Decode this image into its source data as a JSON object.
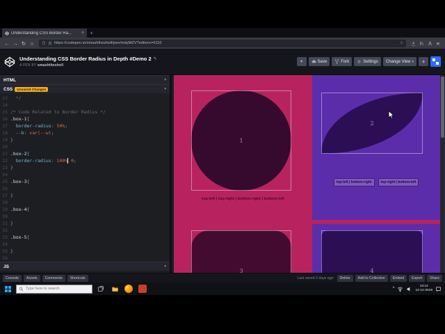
{
  "colors": {
    "pink": "#b8235f",
    "purple": "#5c2dab",
    "shape1": "#360a2e",
    "shape2": "#2c0e55",
    "shape3": "#430b30",
    "shape4": "#2c0e55"
  },
  "browser": {
    "tab_title": "Understanding CSS Border Ra...",
    "close_glyph": "×",
    "new_tab_glyph": "+",
    "back_glyph": "←",
    "forward_glyph": "→",
    "reload_glyph": "↻",
    "home_glyph": "⌂",
    "menu_glyph": "≡",
    "star_glyph": "☆",
    "url": "https://codepen.io/smashtheshell/pen/mdyMZV?editors=0110"
  },
  "pen_header": {
    "title": "Understanding CSS Border Radius in Depth #Demo 2",
    "edit_glyph": "✎",
    "byline_prefix": "A PEN BY",
    "author": "smashtheshell",
    "heart_glyph": "♥",
    "save_label": "Save",
    "fork_label": "Fork",
    "settings_label": "Settings",
    "change_view_label": "Change View",
    "caret_glyph": "▾"
  },
  "editors": {
    "html_label": "HTML",
    "css_label": "CSS",
    "css_badge": "Unsaved Changes",
    "js_label": "JS",
    "caret_glyph": "▾",
    "code_lines": [
      {
        "n": "13",
        "s": [
          {
            "c": "cm",
            "t": "  */"
          }
        ]
      },
      {
        "n": "14",
        "s": []
      },
      {
        "n": "15",
        "s": [
          {
            "c": "cm",
            "t": "/* Code Related to Border Radius */"
          }
        ]
      },
      {
        "n": "16",
        "s": [
          {
            "c": "sel",
            "t": ".box-1"
          },
          {
            "c": "pun",
            "t": "{"
          }
        ]
      },
      {
        "n": "17",
        "s": [
          {
            "c": "prop",
            "t": "  border-radius"
          },
          {
            "c": "pun",
            "t": ":"
          },
          {
            "c": "val",
            "t": " 50%"
          },
          {
            "c": "pun",
            "t": ";"
          }
        ]
      },
      {
        "n": "18",
        "s": [
          {
            "c": "prop",
            "t": "  --b"
          },
          {
            "c": "pun",
            "t": ":"
          },
          {
            "c": "val",
            "t": " var(--w)"
          },
          {
            "c": "pun",
            "t": ";"
          }
        ]
      },
      {
        "n": "19",
        "s": [
          {
            "c": "pun",
            "t": "}"
          }
        ]
      },
      {
        "n": "20",
        "s": []
      },
      {
        "n": "21",
        "s": [
          {
            "c": "sel",
            "t": ".box-2"
          },
          {
            "c": "pun",
            "t": "{"
          }
        ]
      },
      {
        "n": "22",
        "s": [
          {
            "c": "prop",
            "t": "  border-radius"
          },
          {
            "c": "pun",
            "t": ":"
          },
          {
            "c": "val",
            "t": " 100%"
          },
          {
            "c": "cursor",
            "t": ""
          },
          {
            "c": "val",
            "t": " 0"
          },
          {
            "c": "pun",
            "t": ";"
          }
        ]
      },
      {
        "n": "23",
        "s": [
          {
            "c": "pun",
            "t": "}"
          }
        ]
      },
      {
        "n": "24",
        "s": []
      },
      {
        "n": "25",
        "s": [
          {
            "c": "sel",
            "t": ".box-3"
          },
          {
            "c": "pun",
            "t": "{"
          }
        ]
      },
      {
        "n": "26",
        "s": []
      },
      {
        "n": "27",
        "s": [
          {
            "c": "pun",
            "t": "}"
          }
        ]
      },
      {
        "n": "28",
        "s": []
      },
      {
        "n": "29",
        "s": [
          {
            "c": "sel",
            "t": ".box-4"
          },
          {
            "c": "pun",
            "t": "{"
          }
        ]
      },
      {
        "n": "30",
        "s": []
      },
      {
        "n": "31",
        "s": [
          {
            "c": "pun",
            "t": "}"
          }
        ]
      },
      {
        "n": "32",
        "s": []
      },
      {
        "n": "33",
        "s": [
          {
            "c": "sel",
            "t": ".box-5"
          },
          {
            "c": "pun",
            "t": "{"
          }
        ]
      },
      {
        "n": "34",
        "s": []
      },
      {
        "n": "35",
        "s": [
          {
            "c": "pun",
            "t": "}"
          }
        ]
      },
      {
        "n": "36",
        "s": []
      }
    ]
  },
  "preview": {
    "box1_label": "1",
    "box1_caption": "top-left | top-right | bottom-right | bottom-left",
    "box2_label": "2",
    "chip1": "top-left | bottom-right",
    "chip2": "top-right | bottom-left",
    "box3_label": "3",
    "box4_label": "4"
  },
  "pen_footer": {
    "console_label": "Console",
    "assets_label": "Assets",
    "comments_label": "Comments",
    "shortcuts_label": "Shortcuts",
    "last_saved": "Last saved 2 days ago",
    "delete_label": "Delete",
    "collection_label": "Add to Collection",
    "embed_label": "Embed",
    "export_label": "Export",
    "share_label": "Share"
  },
  "taskbar": {
    "search_placeholder": "Type here to search",
    "tray_caret": "^",
    "time": "13:12",
    "date": "12-12-2019"
  }
}
